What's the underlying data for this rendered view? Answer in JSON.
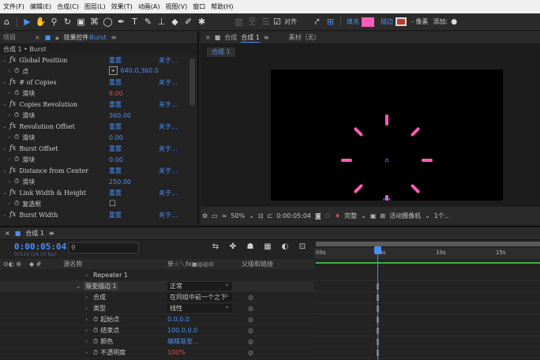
{
  "menubar": [
    "文件(F)",
    "编辑(E)",
    "合成(C)",
    "图层(L)",
    "效果(T)",
    "动画(A)",
    "视图(V)",
    "窗口",
    "帮助(H)"
  ],
  "toolbar": {
    "align_label": "对齐",
    "fill_label": "填充",
    "stroke_label": "描边",
    "pixel_label": "- 像素",
    "add_label": "添加:",
    "fill_color": "#ff5cb5",
    "stroke_color": "#c0392b"
  },
  "effects_panel": {
    "tab_project": "项目",
    "tab_effects": "效果控件",
    "tab_effects_layer": "Burst",
    "breadcrumb": "合成 1 • Burst",
    "reset_label": "重置",
    "about_label": "关于...",
    "rows": [
      {
        "name": "Global Position",
        "sub": "点",
        "value": "640.0,360.0"
      },
      {
        "name": "# of Copies",
        "sub": "滑块",
        "value": "8.00",
        "value_red": true
      },
      {
        "name": "Copies Revolution",
        "sub": "滑块",
        "value": "360.00"
      },
      {
        "name": "Revolution Offset",
        "sub": "滑块",
        "value": "0.00"
      },
      {
        "name": "Burst Offset",
        "sub": "滑块",
        "value": "0.00"
      },
      {
        "name": "Distance from Center",
        "sub": "滑块",
        "value": "250.00"
      },
      {
        "name": "Link Width & Height",
        "sub": "复选框",
        "value": ""
      },
      {
        "name": "Burst Width",
        "sub": "",
        "value": ""
      }
    ]
  },
  "comp_panel": {
    "tab_label": "合成",
    "tab_name": "合成 1",
    "footage_label": "素材（无）",
    "comp_chip": "合成 1",
    "zoom": "50%",
    "timecode": "0:00:05:04",
    "quality": "完整",
    "camera": "活动摄像机",
    "views": "1个..."
  },
  "timeline": {
    "tab_label": "合成 1",
    "timecode": "0:00:05:04",
    "timecode_sub": "00124 (24.00 fps)",
    "search_placeholder": "",
    "col_source": "源名称",
    "col_switches": "单☆＼fx▣◎◎⊙",
    "col_parent": "父级和链接",
    "rows": [
      {
        "indent": 1,
        "name": "Repeater 1",
        "c2": "",
        "c3": ""
      },
      {
        "indent": 0,
        "name": "渐变描边 1",
        "c2_dd": "正常",
        "c3": ""
      },
      {
        "indent": 1,
        "name": "合成",
        "c2_dd": "在同组中前一个之下",
        "c3": "◎"
      },
      {
        "indent": 1,
        "name": "类型",
        "c2_dd": "线性",
        "c3": "◎"
      },
      {
        "indent": 1,
        "name": "起始点",
        "stopwatch": true,
        "c2": "0.0,0.0",
        "c3": "◎"
      },
      {
        "indent": 1,
        "name": "结束点",
        "stopwatch": true,
        "c2": "100.0,0.0",
        "c3": "◎"
      },
      {
        "indent": 1,
        "name": "颜色",
        "stopwatch": true,
        "c2": "编辑渐变...",
        "c3": "◎"
      },
      {
        "indent": 1,
        "name": "不透明度",
        "stopwatch": true,
        "c2": "100%",
        "c2_red": true,
        "c3": "◎"
      }
    ],
    "ruler": [
      "00s",
      "05s",
      "10s",
      "15s"
    ]
  }
}
